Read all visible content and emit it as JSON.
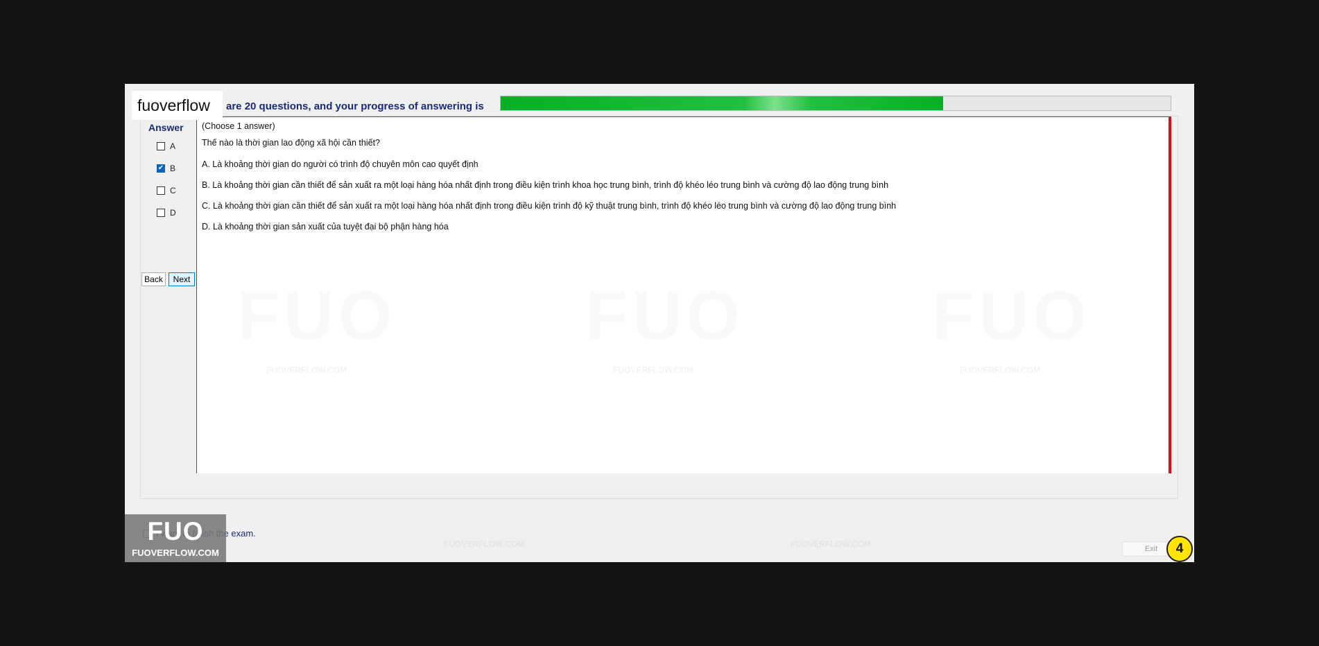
{
  "header": {
    "progress_text": "are 20 questions, and your progress of answering is",
    "progress_fraction": 0.66,
    "brand_label": "fuoverflow"
  },
  "answer_panel": {
    "title": "Answer",
    "options": [
      {
        "label": "A",
        "checked": false
      },
      {
        "label": "B",
        "checked": false
      },
      {
        "label": "C",
        "checked": true
      },
      {
        "label": "D",
        "checked": false
      }
    ],
    "back_label": "Back",
    "next_label": "Next"
  },
  "question": {
    "instruction": "(Choose 1 answer)",
    "text": "Thế nào là thời gian lao động xã hội cần thiết?",
    "choices": [
      "A.  Là khoảng thời gian do người có trình độ chuyên môn cao quyết định",
      "B.  Là khoảng thời gian cần thiết để sản xuất ra một loại hàng hóa nhất định trong điều kiện trình khoa học trung bình, trình độ khéo léo trung bình và cường độ lao động trung bình",
      "C.  Là khoảng thời gian cần thiết để sản xuất ra một loại hàng hóa nhất định trong điều kiện trình độ kỹ thuật trung bình, trình độ khéo léo trung bình và cường độ lao động trung bình",
      "D.  Là khoảng thời gian sản xuất của tuyệt đại bộ phận hàng hóa"
    ]
  },
  "watermark": {
    "big": "FUO",
    "small": "FUOVERFLOW.COM"
  },
  "footer": {
    "finish_label": "I want to finish the exam.",
    "finish_checked": false,
    "exit_label": "Exit",
    "badge_number": "4"
  },
  "logo": {
    "big": "FUO",
    "small": "FUOVERFLOW.COM"
  },
  "colors": {
    "progress_green": "#06b025",
    "accent_navy": "#1a2a7a",
    "red_bar": "#d0131a",
    "badge_yellow": "#ffe500",
    "checkbox_blue": "#0a63c9"
  }
}
